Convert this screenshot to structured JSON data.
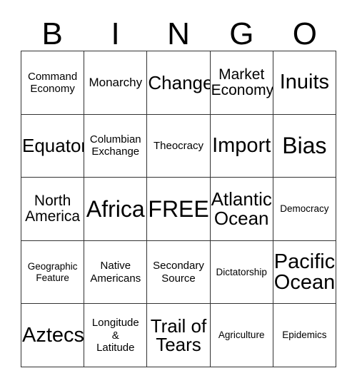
{
  "card": {
    "title": "BINGO",
    "header_letters": [
      "B",
      "I",
      "N",
      "G",
      "O"
    ],
    "grid": {
      "rows": 5,
      "columns": 5,
      "free_space_label": "FREE!",
      "border_color": "#333333",
      "background_color": "#ffffff",
      "text_color": "#000000"
    },
    "cells": [
      [
        {
          "text": "Command\nEconomy",
          "size": "xs"
        },
        {
          "text": "Monarchy",
          "size": "sm"
        },
        {
          "text": "Change",
          "size": "lg"
        },
        {
          "text": "Market\nEconomy",
          "size": "md"
        },
        {
          "text": "Inuits",
          "size": "xl"
        }
      ],
      [
        {
          "text": "Equator",
          "size": "lg"
        },
        {
          "text": "Columbian\nExchange",
          "size": "xs"
        },
        {
          "text": "Theocracy",
          "size": "xs"
        },
        {
          "text": "Import",
          "size": "xl"
        },
        {
          "text": "Bias",
          "size": "xxl"
        }
      ],
      [
        {
          "text": "North\nAmerica",
          "size": "md"
        },
        {
          "text": "Africa",
          "size": "xxl"
        },
        {
          "text": "FREE!",
          "size": "xxl"
        },
        {
          "text": "Atlantic\nOcean",
          "size": "lg"
        },
        {
          "text": "Democracy",
          "size": "xxs"
        }
      ],
      [
        {
          "text": "Geographic\nFeature",
          "size": "xxs"
        },
        {
          "text": "Native\nAmericans",
          "size": "xs"
        },
        {
          "text": "Secondary\nSource",
          "size": "xs"
        },
        {
          "text": "Dictatorship",
          "size": "xxs"
        },
        {
          "text": "Pacific\nOcean",
          "size": "xl"
        }
      ],
      [
        {
          "text": "Aztecs",
          "size": "xl"
        },
        {
          "text": "Longitude\n&\nLatitude",
          "size": "xs"
        },
        {
          "text": "Trail of\nTears",
          "size": "lg"
        },
        {
          "text": "Agriculture",
          "size": "xxs"
        },
        {
          "text": "Epidemics",
          "size": "xxs"
        }
      ]
    ]
  }
}
